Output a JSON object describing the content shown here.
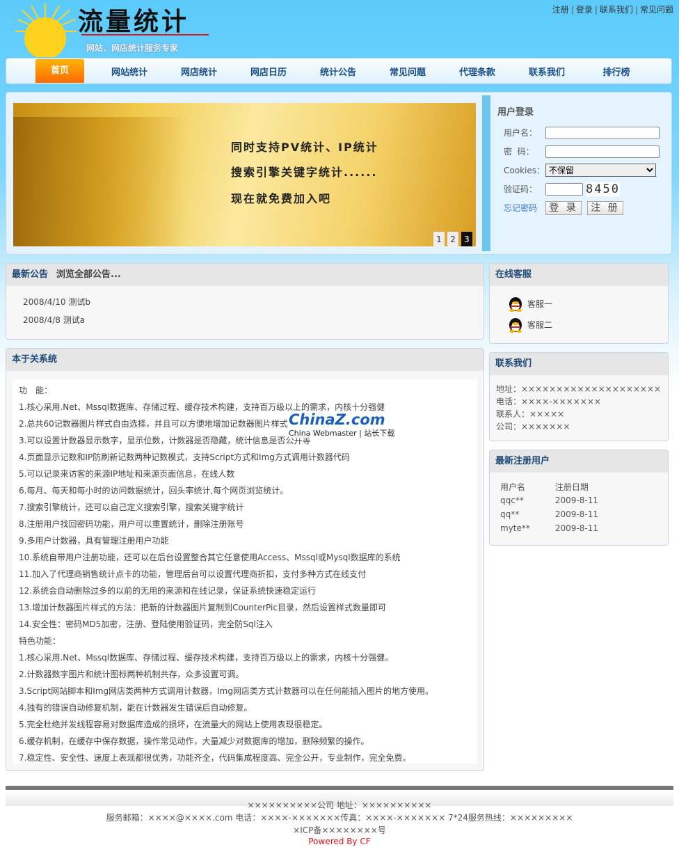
{
  "header": {
    "logo_text": "流量统计",
    "slogan": "网站、网店统计服务专家",
    "top_links": [
      "注册",
      "登录",
      "联系我们",
      "常见问题"
    ]
  },
  "nav": {
    "items": [
      "首页",
      "网站统计",
      "网店统计",
      "网店日历",
      "统计公告",
      "常见问题",
      "代理条款",
      "联系我们",
      "排行榜"
    ],
    "active": 0
  },
  "banner": {
    "lines": [
      "同时支持PV统计、IP统计",
      "搜索引擎关键字统计......",
      "现在就免费加入吧"
    ],
    "pages": [
      "1",
      "2",
      "3"
    ],
    "current_page": 3
  },
  "login": {
    "title": "用户登录",
    "username_label": "用户名：",
    "password_label": "密  码：",
    "cookies_label": "Cookies：",
    "cookies_value": "不保留",
    "captcha_label": "验证码：",
    "captcha": "8450",
    "forgot": "忘记密码",
    "login_button": "登 录",
    "register_button": "注 册"
  },
  "notice": {
    "title": "最新公告",
    "more": "浏览全部公告...",
    "items": [
      "2008/4/10  测试b",
      "2008/4/8  测试a"
    ]
  },
  "about": {
    "title": "本于关系统",
    "lines": [
      "功　能：",
      "1.核心采用.Net、Mssql数据库、存储过程、缓存技术构建，支持百万级以上的需求，内核十分强健",
      "2.总共60记数器图片样式自由选择，并且可以方便地增加记数器图片样式",
      "3.可以设置计数器显示数字，显示位数，计数器是否隐藏，统计信息是否公开等",
      "4.页面显示记数和IP防刷新记数两种记数模式，支持Script方式和Img方式调用计数器代码",
      "5.可以记录来访客的来源IP地址和来源页面信息，在线人数",
      "6.每月、每天和每小时的访问数据统计，回头率统计,每个网页浏览统计。",
      "7.搜索引擎统计，还可以自己定义搜索引擎，搜索关键字统计",
      "8.注册用户找回密码功能，用户可以重置统计，删除注册账号",
      "9.多用户计数器，具有管理注册用户功能",
      "10.系统自带用户注册功能，还可以在后台设置整合其它任意使用Access、Mssql或Mysql数据库的系统",
      "11.加入了代理商销售统计点卡的功能，管理后台可以设置代理商折扣，支付多种方式在线支付",
      "12.系统会自动删除过多的以前的无用的来源和在线记录，保证系统快速稳定运行",
      "13.增加计数器图片样式的方法：把新的计数器图片复制到CounterPic目录，然后设置样式数量即可",
      "14.安全性：密码MD5加密，注册、登陆使用验证码，完全防Sql注入",
      "特色功能：",
      "1.核心采用.Net、Mssql数据库、存储过程、缓存技术构建，支持百万级以上的需求，内核十分强健。",
      "2.计数器数字图片和统计图标两种机制共存，众多设置可调。",
      "3.Script网站脚本和Img网店类两种方式调用计数器，Img网店类方式计数器可以在任何能插入图片的地方使用。",
      "4.独有的错误自动修复机制，能在计数器发生错误后自动修复。",
      "5.完全杜绝并发线程容易对数据库造成的损坏，在流量大的网站上使用表现很稳定。",
      "6.缓存机制，在缓存中保存数据，操作常见动作，大量减少对数据库的增加，删除频繁的操作。",
      "7.稳定性、安全性、速度上表现都很优秀，功能齐全，代码集成程度高、完全公开，专业制作，完全免费。"
    ]
  },
  "watermark": {
    "brand": "ChinaZ.com",
    "sub": "China Webmaster | 站长下载"
  },
  "service": {
    "title": "在线客服",
    "items": [
      "客服一",
      "客服二"
    ]
  },
  "contact": {
    "title": "联系我们",
    "lines": [
      "地址：××××××××××××××××××××",
      "电话：××××-×××××××",
      "联系人：×××××",
      "公司：×××××××"
    ]
  },
  "users": {
    "title": "最新注册用户",
    "headers": [
      "用户名",
      "注册日期"
    ],
    "rows": [
      [
        "qqc**",
        "2009-8-11"
      ],
      [
        "qq**",
        "2009-8-11"
      ],
      [
        "myte**",
        "2009-8-11"
      ]
    ]
  },
  "footer": {
    "lines": [
      "××××××××××公司 地址：××××××××××",
      "服务邮箱：××××@××××.com 电话：××××-×××××××传真：××××-××××××× 7*24服务热线：×××××××××",
      "×ICP备××××××××号"
    ],
    "powered": "Powered By CF"
  }
}
